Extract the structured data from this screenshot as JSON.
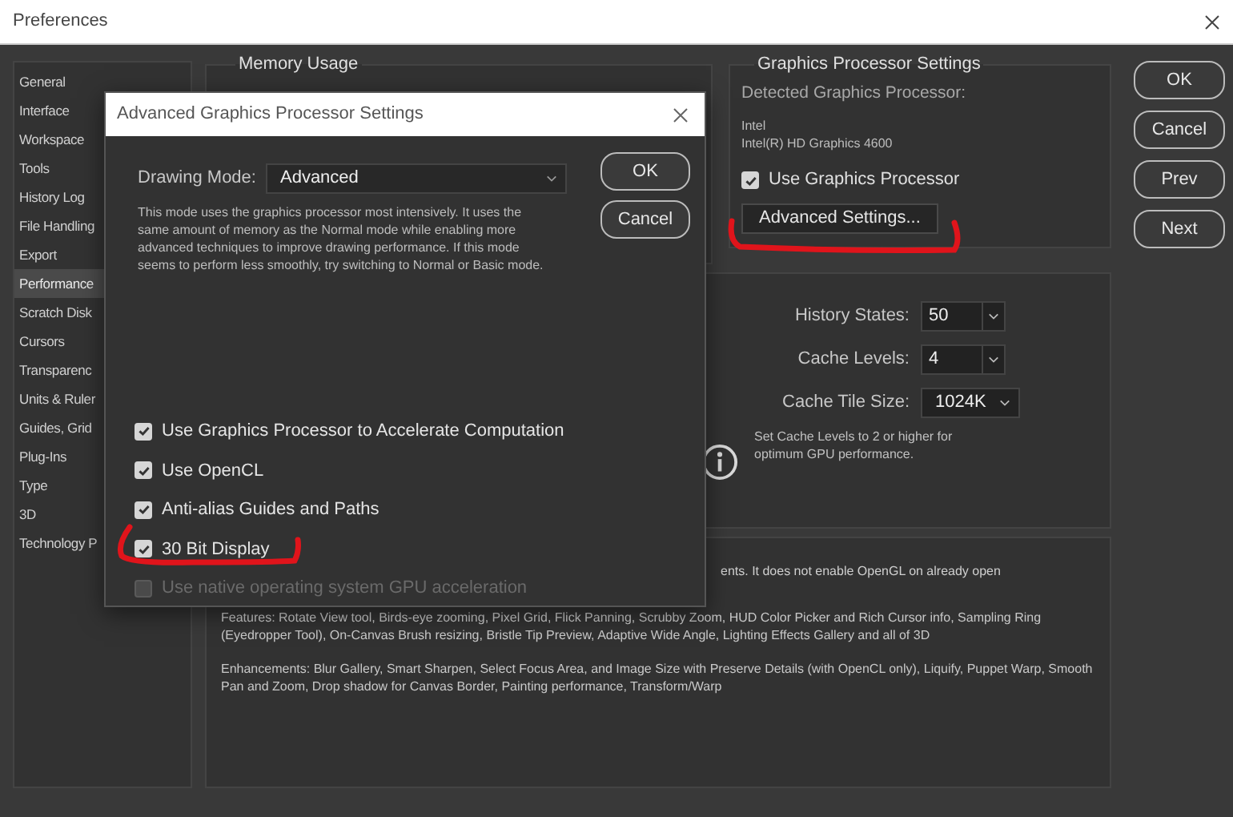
{
  "window": {
    "title": "Preferences"
  },
  "sidebar": {
    "items": [
      {
        "label": "General",
        "selected": false
      },
      {
        "label": "Interface",
        "selected": false
      },
      {
        "label": "Workspace",
        "selected": false
      },
      {
        "label": "Tools",
        "selected": false
      },
      {
        "label": "History Log",
        "selected": false
      },
      {
        "label": "File Handling",
        "selected": false
      },
      {
        "label": "Export",
        "selected": false
      },
      {
        "label": "Performance",
        "selected": true
      },
      {
        "label": "Scratch Disk",
        "selected": false
      },
      {
        "label": "Cursors",
        "selected": false
      },
      {
        "label": "Transparenc",
        "selected": false
      },
      {
        "label": "Units & Ruler",
        "selected": false
      },
      {
        "label": "Guides, Grid",
        "selected": false
      },
      {
        "label": "Plug-Ins",
        "selected": false
      },
      {
        "label": "Type",
        "selected": false
      },
      {
        "label": "3D",
        "selected": false
      },
      {
        "label": "Technology P",
        "selected": false
      }
    ]
  },
  "memory_usage": {
    "title": "Memory Usage"
  },
  "gpu_settings": {
    "title": "Graphics Processor Settings",
    "detected_label": "Detected Graphics Processor:",
    "vendor": "Intel",
    "model": "Intel(R) HD Graphics 4600",
    "use_gpu": {
      "label": "Use Graphics Processor",
      "checked": true
    },
    "advanced_button": "Advanced Settings..."
  },
  "history": {
    "fields": [
      {
        "label": "History States:",
        "value": "50",
        "kind": "combo"
      },
      {
        "label": "Cache Levels:",
        "value": "4",
        "kind": "combo"
      },
      {
        "label": "Cache Tile Size:",
        "value": "1024K",
        "kind": "select"
      }
    ],
    "note": "Set Cache Levels to 2 or higher for optimum GPU performance."
  },
  "description": {
    "fragment": "ents. It does not enable OpenGL on already open",
    "paragraphs": [
      "Features: Rotate View tool, Birds-eye zooming, Pixel Grid, Flick Panning, Scrubby Zoom, HUD Color Picker and Rich Cursor info, Sampling Ring (Eyedropper Tool), On-Canvas Brush resizing, Bristle Tip Preview, Adaptive Wide Angle, Lighting Effects Gallery and all of 3D",
      "Enhancements: Blur Gallery, Smart Sharpen, Select Focus Area, and Image Size with Preserve Details (with OpenCL only), Liquify, Puppet Warp, Smooth Pan and Zoom, Drop shadow for Canvas Border, Painting performance, Transform/Warp"
    ]
  },
  "buttons": [
    "OK",
    "Cancel",
    "Prev",
    "Next"
  ],
  "dialog": {
    "title": "Advanced Graphics Processor Settings",
    "drawing_mode": {
      "label": "Drawing Mode:",
      "value": "Advanced"
    },
    "description": "This mode uses the graphics processor most intensively.  It uses the same amount of memory as the Normal mode while enabling more advanced techniques to improve drawing performance.  If this mode seems to perform less smoothly, try switching to Normal or Basic mode.",
    "buttons": [
      "OK",
      "Cancel"
    ],
    "options": [
      {
        "label": "Use Graphics Processor to Accelerate Computation",
        "checked": true,
        "disabled": false
      },
      {
        "label": "Use OpenCL",
        "checked": true,
        "disabled": false
      },
      {
        "label": "Anti-alias Guides and Paths",
        "checked": true,
        "disabled": false
      },
      {
        "label": "30 Bit Display",
        "checked": true,
        "disabled": false
      },
      {
        "label": "Use native operating system GPU acceleration",
        "checked": false,
        "disabled": true
      }
    ]
  }
}
